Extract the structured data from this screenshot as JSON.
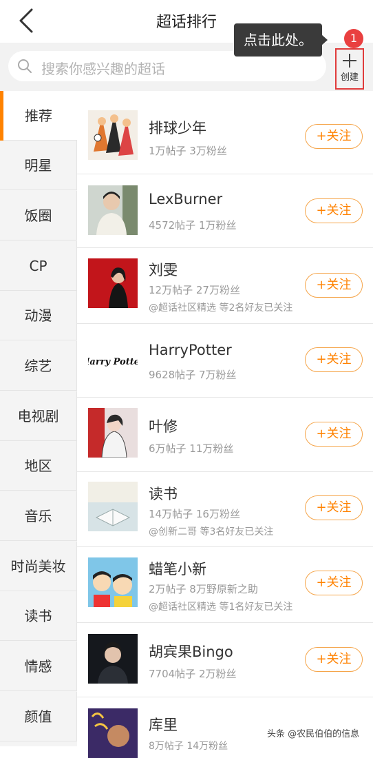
{
  "header": {
    "title": "超话排行",
    "tooltip": "点击此处。",
    "badge": "1"
  },
  "search": {
    "placeholder": "搜索你感兴趣的超话"
  },
  "create": {
    "label": "创建"
  },
  "categories": [
    "推荐",
    "明星",
    "饭圈",
    "CP",
    "动漫",
    "综艺",
    "电视剧",
    "地区",
    "音乐",
    "时尚美妆",
    "读书",
    "情感",
    "颜值"
  ],
  "follow_label": "+关注",
  "items": [
    {
      "name": "排球少年",
      "stats": "1万帖子 3万粉丝",
      "extra": ""
    },
    {
      "name": "LexBurner",
      "stats": "4572帖子 1万粉丝",
      "extra": ""
    },
    {
      "name": "刘雯",
      "stats": "12万帖子 27万粉丝",
      "extra": "@超话社区精选 等2名好友已关注"
    },
    {
      "name": "HarryPotter",
      "stats": "9628帖子 7万粉丝",
      "extra": ""
    },
    {
      "name": "叶修",
      "stats": "6万帖子 11万粉丝",
      "extra": ""
    },
    {
      "name": "读书",
      "stats": "14万帖子 16万粉丝",
      "extra": "@创新二哥 等3名好友已关注"
    },
    {
      "name": "蜡笔小新",
      "stats": "2万帖子 8万野原新之助",
      "extra": "@超话社区精选 等1名好友已关注"
    },
    {
      "name": "胡宾果Bingo",
      "stats": "7704帖子 2万粉丝",
      "extra": ""
    },
    {
      "name": "库里",
      "stats": "8万帖子 14万粉丝",
      "extra": ""
    }
  ],
  "harry_logo_text": "Harry Potter",
  "watermark": "头条 @农民伯伯的信息"
}
